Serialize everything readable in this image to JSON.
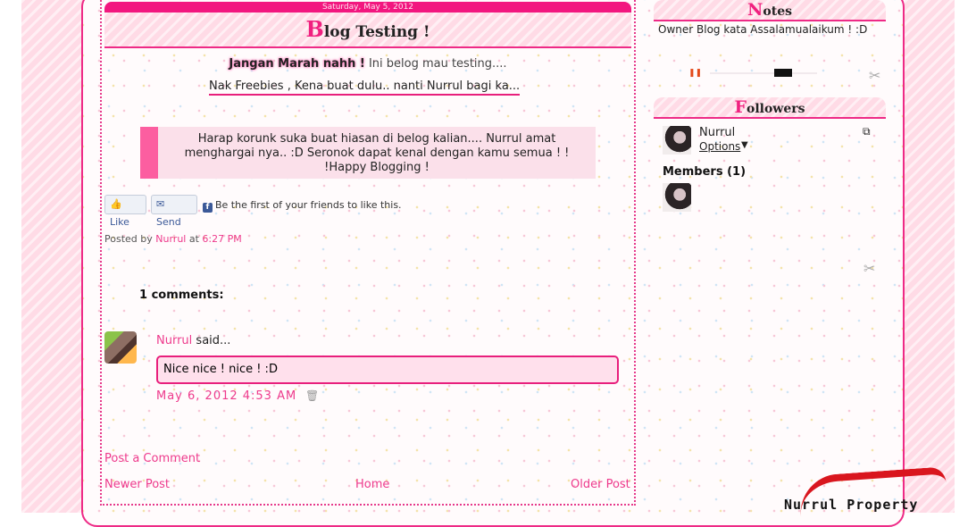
{
  "post": {
    "date": "Saturday, May 5, 2012",
    "title_cap": "B",
    "title_rest": "log Testing !",
    "line1_bold": "Jangan Marah nahh !",
    "line1_rest": " Ini belog mau testing....",
    "line2": "Nak Freebies , Kena buat dulu.. nanti Nurrul bagi ka...",
    "quote": "Harap korunk suka buat hiasan di belog kalian.... Nurrul amat menghargai nya.. :D Seronok dapat kenal dengan kamu semua ! ! !Happy Blogging !",
    "posted_by_label": "Posted by",
    "author": "Nurrul",
    "at_label": "at",
    "time": "6:27 PM"
  },
  "facebook": {
    "like_label": "Like",
    "send_label": "Send",
    "social_text": "Be the first of your friends to like this."
  },
  "comments": {
    "heading": "1 comments:",
    "author": "Nurrul",
    "said": "said...",
    "body": "Nice nice ! nice ! :D",
    "timestamp": "May 6, 2012 4:53 AM"
  },
  "nav": {
    "post_comment": "Post a Comment",
    "newer": "Newer Post",
    "home": "Home",
    "older": "Older Post"
  },
  "sidebar": {
    "notes_cap": "N",
    "notes_rest": "otes",
    "notes_text": "Owner Blog kata Assalamualaikum ! :D",
    "followers_cap": "F",
    "followers_rest": "ollowers",
    "follower_name": "Nurrul",
    "options_label": "Options",
    "members_label": "Members (1)"
  },
  "logo_text": "Nurrul Property",
  "icons": [
    "facebook-logo-icon",
    "trash-icon",
    "pause-icon",
    "tools-icon",
    "popout-icon",
    "chevron-down-icon"
  ],
  "colors": {
    "accent": "#ee2a86",
    "link": "#ee3a8c",
    "quote_bar": "#fc5ea0"
  }
}
